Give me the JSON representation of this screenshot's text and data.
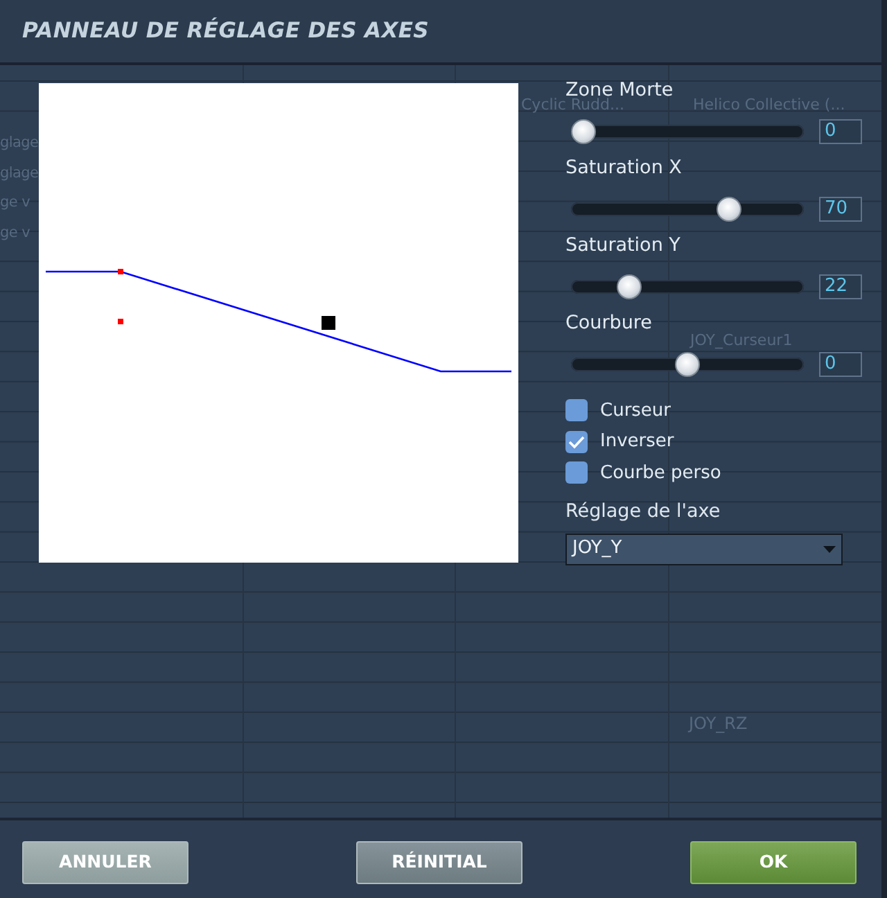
{
  "window": {
    "title": "PANNEAU DE RÉGLAGE DES AXES"
  },
  "background": {
    "header_cells": [
      "Cyclic Rudd...",
      "Helico Collective (..."
    ],
    "left_cells": [
      "glage",
      "glage",
      "ge v",
      "ge v"
    ],
    "cells": [
      "JOY_Curseur1",
      "JOY_RZ"
    ]
  },
  "sliders": [
    {
      "label": "Zone Morte",
      "level": 0.0,
      "value": "0"
    },
    {
      "label": "Saturation X",
      "level": 0.7,
      "value": "70"
    },
    {
      "label": "Saturation Y",
      "level": 0.22,
      "value": "22"
    },
    {
      "label": "Courbure",
      "level": 0.5,
      "value": "0"
    }
  ],
  "checkboxes": [
    {
      "label": "Curseur",
      "checked": false
    },
    {
      "label": "Inverser",
      "checked": true
    },
    {
      "label": "Courbe perso",
      "checked": false
    }
  ],
  "axis": {
    "label": "Réglage de l'axe",
    "value": "JOY_Y"
  },
  "buttons": [
    {
      "label": "ANNULER",
      "kind": "cancel"
    },
    {
      "label": "RÉINITIAL",
      "kind": "reset"
    },
    {
      "label": "OK",
      "kind": "ok"
    }
  ]
}
